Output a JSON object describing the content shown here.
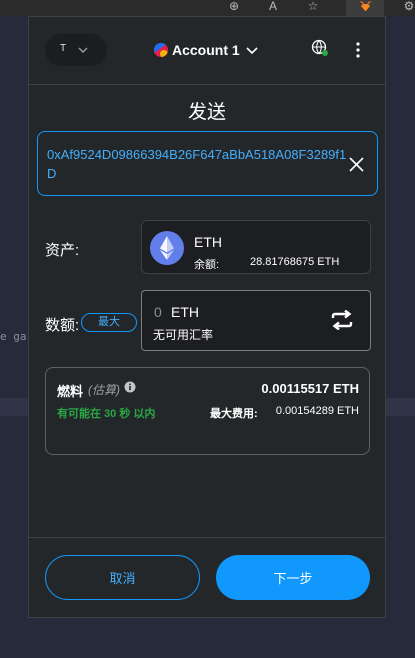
{
  "background": {
    "code_left": "e ga",
    "code_right": "",
    "browser_icons": [
      "zoom-icon",
      "read-aloud-icon",
      "favorite-icon",
      "metamask-fox-icon",
      "extensions-icon"
    ]
  },
  "header": {
    "network_label": "T",
    "account_name": "Account 1",
    "colors": {
      "accent": "#1098fc",
      "success": "#28a745"
    }
  },
  "page": {
    "title": "发送"
  },
  "recipient": {
    "address": "0xAf9524D09866394B26F647aBbA518A08F3289f1D"
  },
  "asset": {
    "label": "资产:",
    "symbol": "ETH",
    "balance_label": "余额:",
    "balance_value": "28.81768675 ETH"
  },
  "amount": {
    "label": "数额:",
    "max_label": "最大",
    "value": "0",
    "unit": "ETH",
    "conversion_note": "无可用汇率"
  },
  "gas": {
    "title": "燃料",
    "estimate_label": "(估算)",
    "fee": "0.00115517 ETH",
    "likely_text": "有可能在 30 秒 以内",
    "max_fee_label": "最大费用:",
    "max_fee_value": "0.00154289 ETH"
  },
  "footer": {
    "cancel_label": "取消",
    "next_label": "下一步"
  }
}
